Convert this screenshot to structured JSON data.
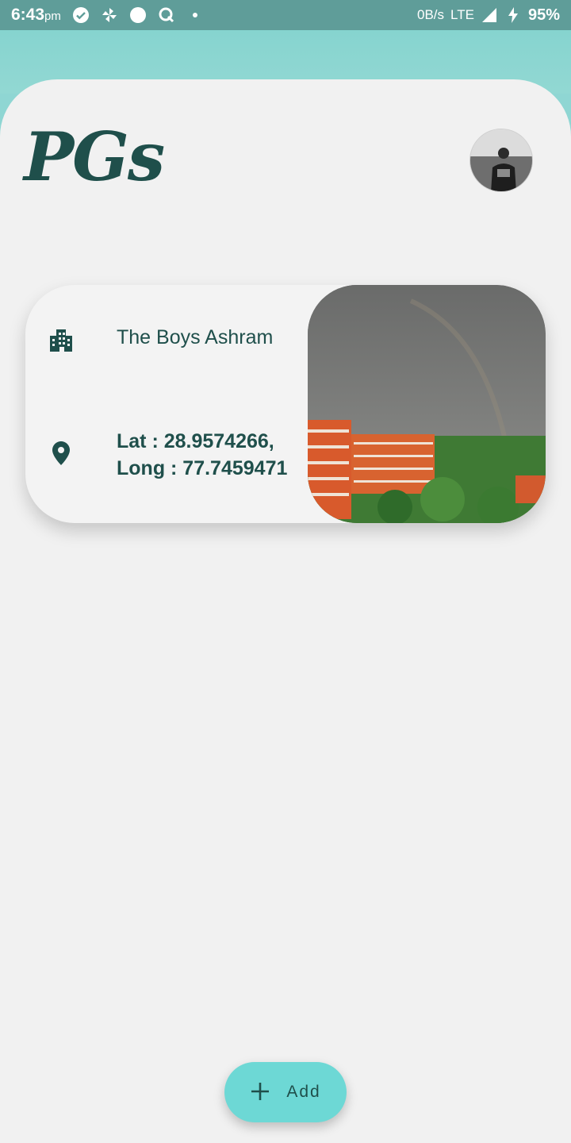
{
  "status_bar": {
    "time": "6:43",
    "ampm": "pm",
    "network_speed": "0B/s",
    "network_type": "LTE",
    "battery": "95%"
  },
  "header": {
    "title": "PGs"
  },
  "listing": {
    "name": "The Boys Ashram",
    "lat_line": "Lat : 28.9574266,",
    "long_line": "Long : 77.7459471"
  },
  "fab": {
    "label": "Add",
    "icon": "plus-icon"
  },
  "colors": {
    "accent": "#6dd8d5",
    "text": "#1f4f4b",
    "status_bar": "#5f9d99",
    "background": "#f1f1f1"
  }
}
